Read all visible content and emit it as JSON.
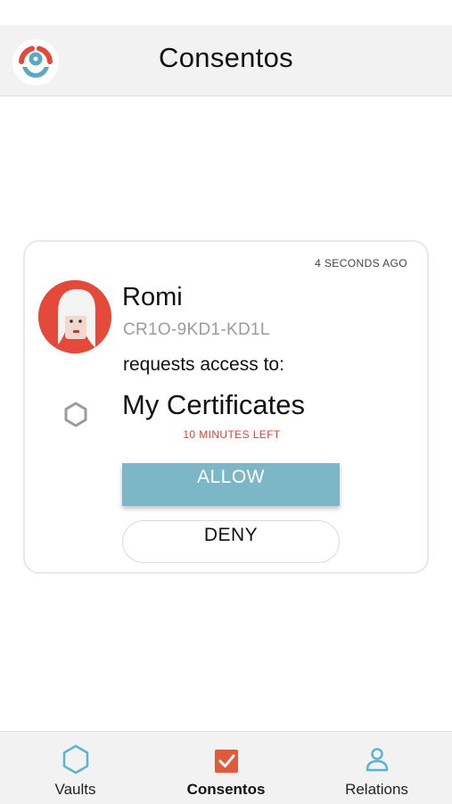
{
  "header": {
    "title": "Consentos",
    "logo_icon": "app-logo-icon"
  },
  "consent_request": {
    "timestamp": "4 SECONDS AGO",
    "requester_name": "Romi",
    "requester_id": "CR1O-9KD1-KD1L",
    "request_text": "requests access to:",
    "resource_icon": "hexagon-icon",
    "resource_name": "My Certificates",
    "time_left": "10 MINUTES LEFT",
    "allow_label": "ALLOW",
    "deny_label": "DENY"
  },
  "bottom_nav": {
    "items": [
      {
        "label": "Vaults",
        "icon": "hexagon-icon",
        "active": false
      },
      {
        "label": "Consentos",
        "icon": "checkbox-icon",
        "active": true
      },
      {
        "label": "Relations",
        "icon": "user-icon",
        "active": false
      }
    ]
  },
  "colors": {
    "accent_teal": "#7bb7c7",
    "accent_red": "#d9422e",
    "avatar_background": "#e4493a",
    "header_background": "#f2f2f2"
  }
}
